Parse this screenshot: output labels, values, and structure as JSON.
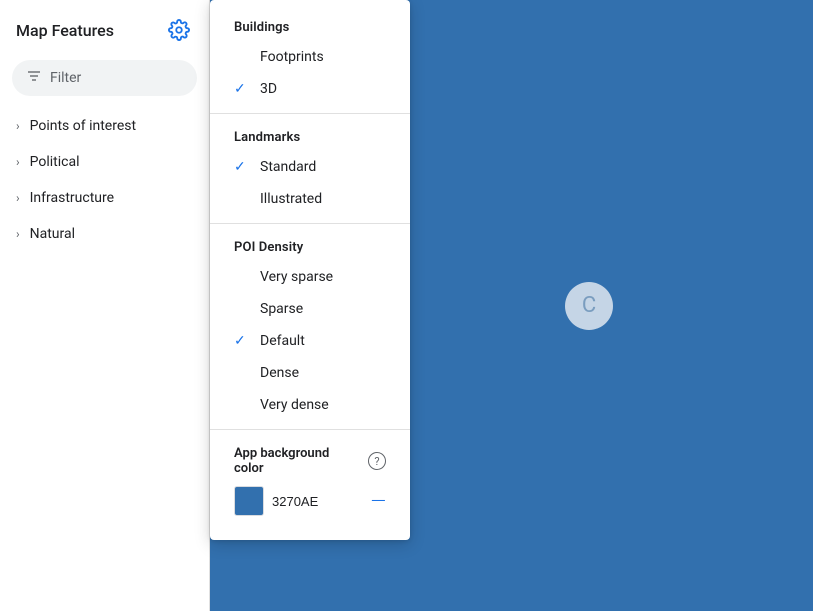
{
  "sidebar": {
    "title": "Map Features",
    "filter": {
      "placeholder": "Filter",
      "icon": "filter-icon"
    },
    "nav_items": [
      {
        "label": "Points of interest"
      },
      {
        "label": "Political"
      },
      {
        "label": "Infrastructure"
      },
      {
        "label": "Natural"
      }
    ]
  },
  "dropdown": {
    "sections": [
      {
        "id": "buildings",
        "header": "Buildings",
        "items": [
          {
            "label": "Footprints",
            "checked": false
          },
          {
            "label": "3D",
            "checked": true
          }
        ]
      },
      {
        "id": "landmarks",
        "header": "Landmarks",
        "items": [
          {
            "label": "Standard",
            "checked": true
          },
          {
            "label": "Illustrated",
            "checked": false
          }
        ]
      },
      {
        "id": "poi_density",
        "header": "POI Density",
        "items": [
          {
            "label": "Very sparse",
            "checked": false
          },
          {
            "label": "Sparse",
            "checked": false
          },
          {
            "label": "Default",
            "checked": true
          },
          {
            "label": "Dense",
            "checked": false
          },
          {
            "label": "Very dense",
            "checked": false
          }
        ]
      }
    ],
    "app_bg_color": {
      "label": "App background color",
      "value": "3270AE",
      "clear_label": "—"
    }
  },
  "map": {
    "spinner_letter": "C",
    "bg_color": "#3270AE"
  }
}
